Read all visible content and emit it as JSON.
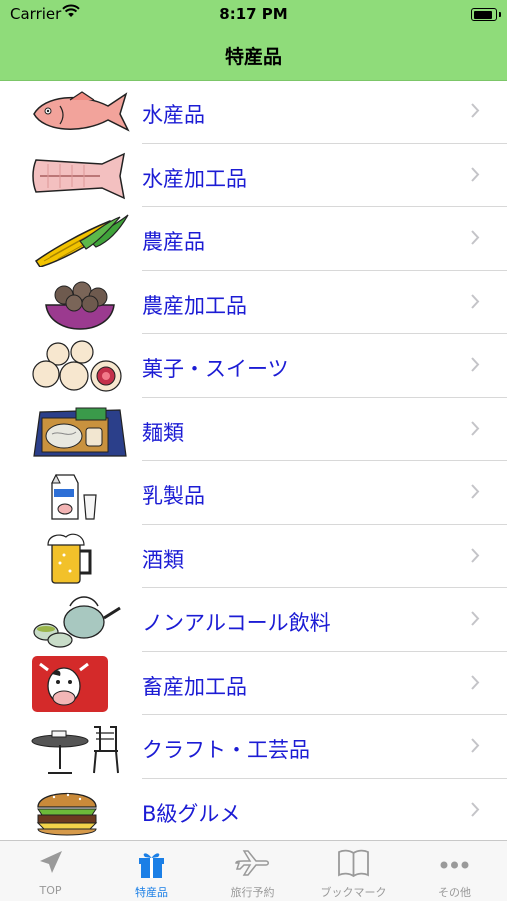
{
  "status": {
    "carrier": "Carrier",
    "time": "8:17 PM"
  },
  "nav": {
    "title": "特産品"
  },
  "list": {
    "items": [
      {
        "label": "水産品",
        "icon": "fish-icon"
      },
      {
        "label": "水産加工品",
        "icon": "dried-fish-icon"
      },
      {
        "label": "農産品",
        "icon": "corn-icon"
      },
      {
        "label": "農産加工品",
        "icon": "taro-bowl-icon"
      },
      {
        "label": "菓子・スイーツ",
        "icon": "daifuku-icon"
      },
      {
        "label": "麺類",
        "icon": "noodle-tray-icon"
      },
      {
        "label": "乳製品",
        "icon": "milk-icon"
      },
      {
        "label": "酒類",
        "icon": "beer-mug-icon"
      },
      {
        "label": "ノンアルコール飲料",
        "icon": "teapot-icon"
      },
      {
        "label": "畜産加工品",
        "icon": "beef-cow-icon"
      },
      {
        "label": "クラフト・工芸品",
        "icon": "table-chair-icon"
      },
      {
        "label": "B級グルメ",
        "icon": "burger-icon"
      }
    ]
  },
  "tabs": [
    {
      "label": "TOP",
      "icon": "navigation-arrow-icon",
      "active": false
    },
    {
      "label": "特産品",
      "icon": "gift-icon",
      "active": true
    },
    {
      "label": "旅行予約",
      "icon": "airplane-icon",
      "active": false
    },
    {
      "label": "ブックマーク",
      "icon": "book-icon",
      "active": false
    },
    {
      "label": "その他",
      "icon": "more-dots-icon",
      "active": false
    }
  ],
  "colors": {
    "nav_background": "#8fdc7a",
    "label_text": "#1c1cd4",
    "tab_active": "#1b7fe6",
    "tab_inactive": "#999999"
  }
}
